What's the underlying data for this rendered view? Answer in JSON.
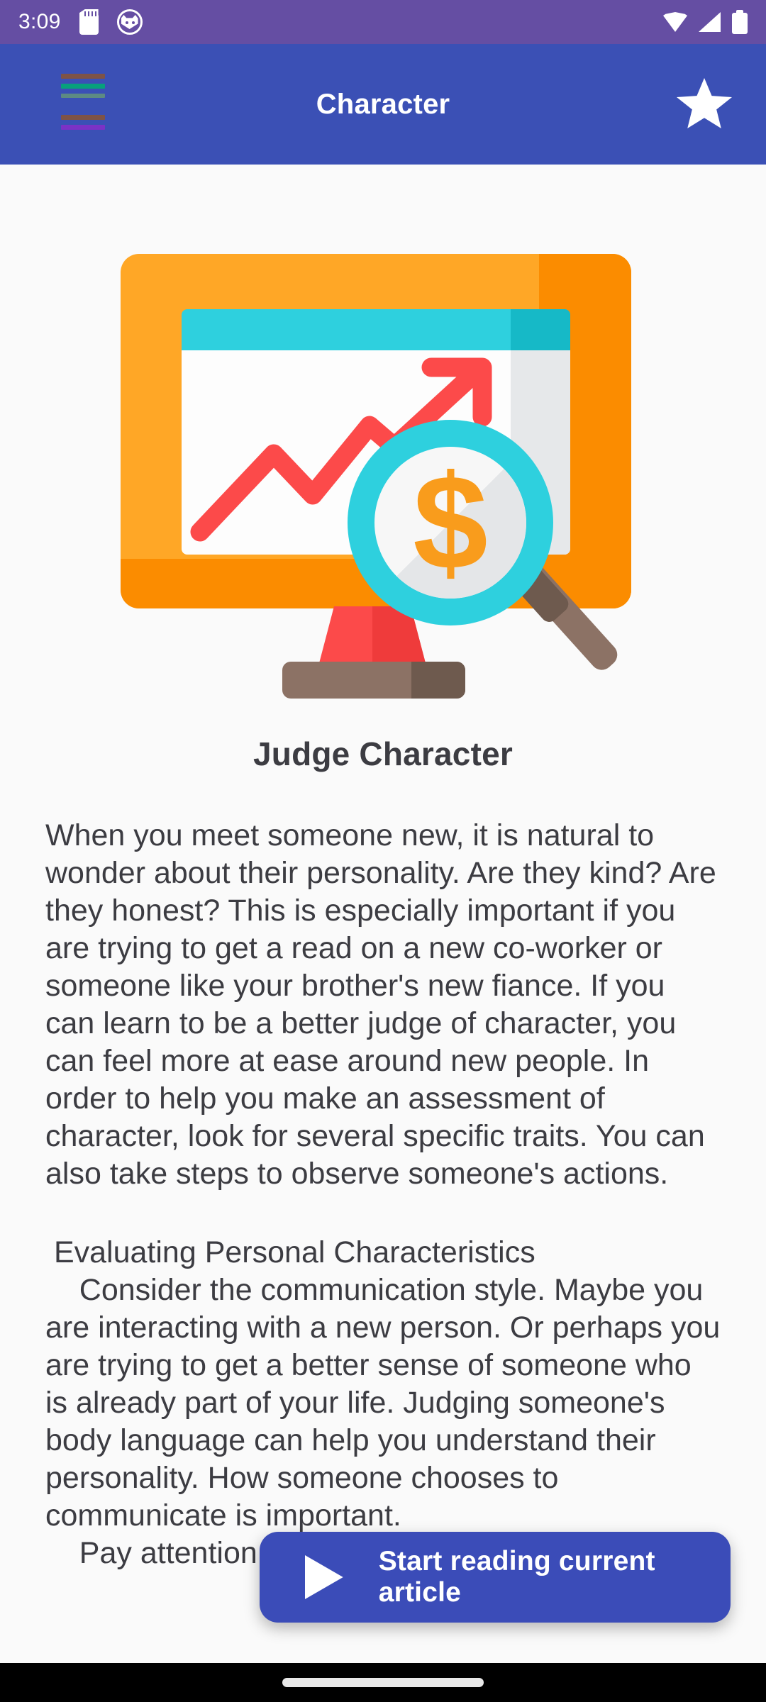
{
  "status_bar": {
    "time": "3:09",
    "background": "#654ea3",
    "icons": {
      "sd_card": "sd-card-icon",
      "cat_face": "cat-face-icon",
      "wifi": "wifi-icon",
      "signal": "cellular-signal-icon",
      "battery": "battery-icon"
    }
  },
  "app_bar": {
    "title": "Character",
    "background": "#3b50b5",
    "menu_icon": "hamburger-menu-icon",
    "menu_bar_colors": [
      "#7d5347",
      "#07a07c",
      "#5d8a83",
      "#7d5347",
      "#7b32c6"
    ],
    "favorite_icon": "star-icon"
  },
  "illustration": {
    "name": "analytics-monitor-magnifier-illustration",
    "colors": {
      "monitor": "#ffa726",
      "monitor_shadow": "#fb8c00",
      "title_bar": "#2ed0de",
      "screen": "#fdfdfd",
      "chart_line": "#fc4a4a",
      "magnifier_ring": "#2ed0de",
      "lens": "#f7f7f7",
      "dollar": "#f99c1c",
      "handle": "#8c7265",
      "stand": "#fc4a4a",
      "base": "#8c7265"
    },
    "dollar_symbol": "$"
  },
  "article": {
    "title": "Judge Character",
    "paragraphs": [
      "When you meet someone new, it is natural to wonder about their personality. Are they kind? Are they honest? This is especially important if you are trying to get a read on a new co-worker or someone like your brother's new fiance. If you can learn to be a better judge of character, you can feel more at ease around new people. In order to help you make an assessment of character, look for several specific traits. You can also take steps to observe someone's actions.",
      " Evaluating Personal Characteristics\n    Consider the communication style. Maybe you are interacting with a new person. Or perhaps you are trying to get a better sense of someone who is already part of your life. Judging someone's body language can help you understand their personality. How someone chooses to communicate is important.\n    Pay attention to the amount of talking that"
    ],
    "text_color": "#3c3c42",
    "background": "#fafafa"
  },
  "floating_button": {
    "label": "Start reading current article",
    "icon": "play-icon",
    "background": "#3b4cb8",
    "text_color": "#ffffff"
  },
  "nav_bar": {
    "background": "#000000",
    "gesture_pill": "home-gesture-pill"
  }
}
